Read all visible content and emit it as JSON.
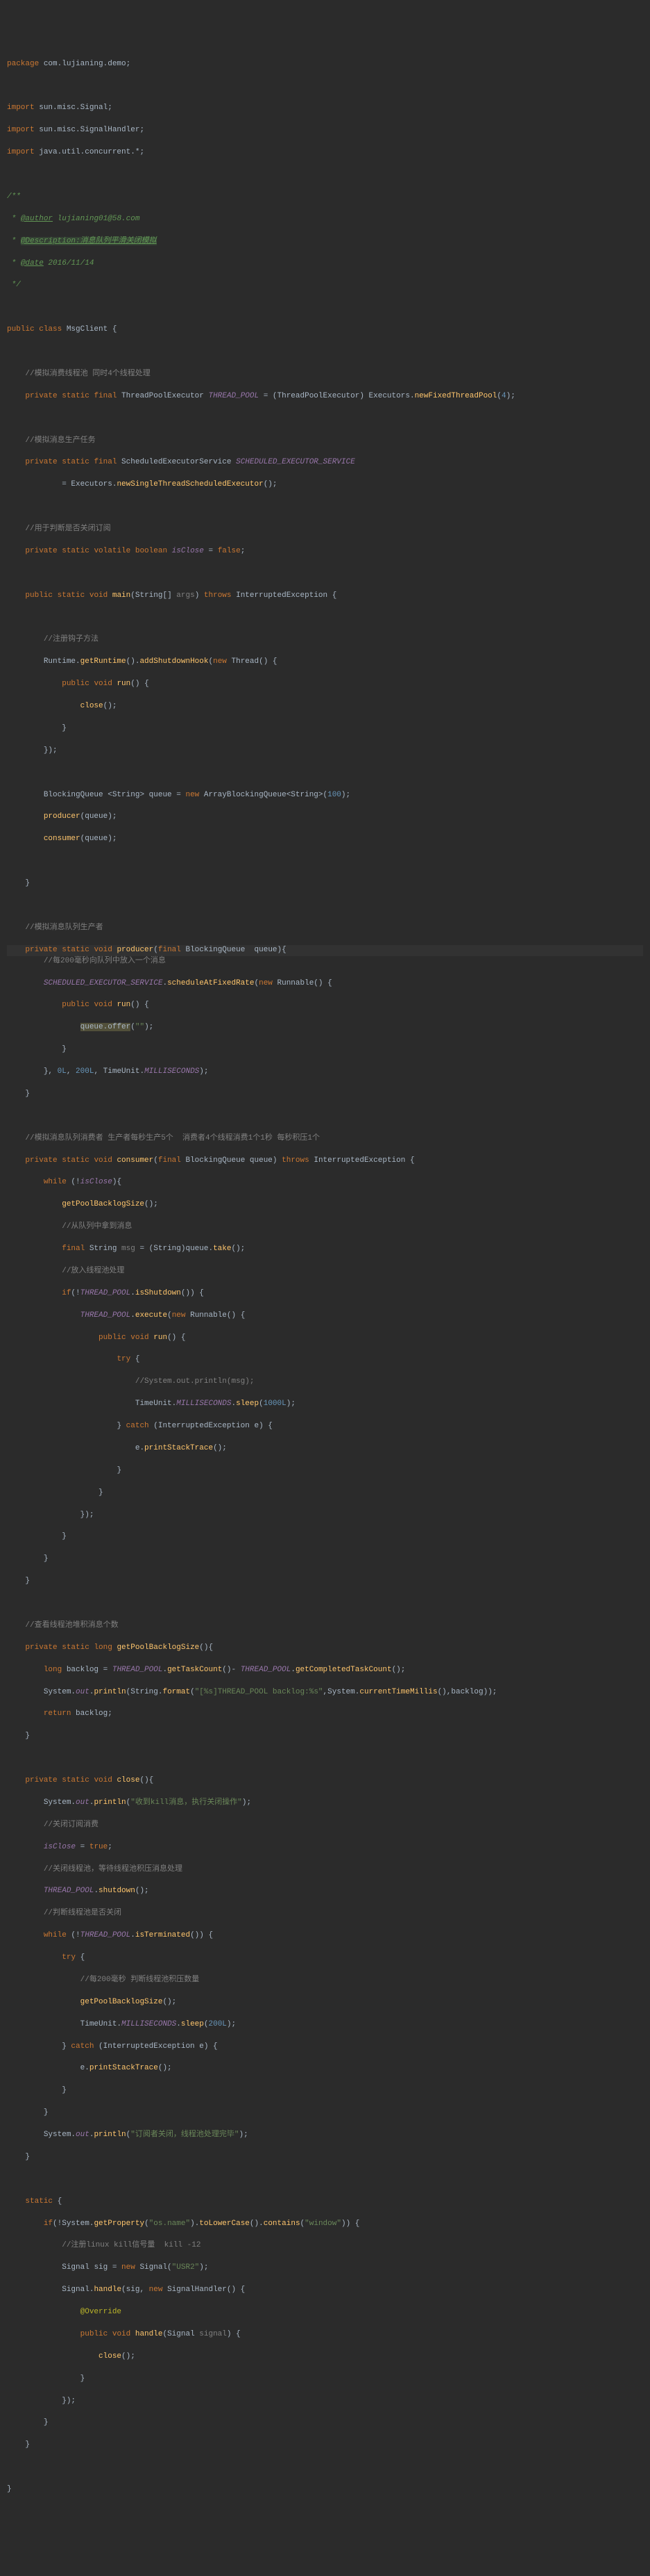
{
  "package_kw": "package ",
  "package_name": "com.lujianing.demo",
  "imports": [
    {
      "kw": "import ",
      "pkg": "sun.misc.Signal"
    },
    {
      "kw": "import ",
      "pkg": "sun.misc.SignalHandler"
    },
    {
      "kw": "import ",
      "pkg": "java.util.concurrent.*"
    }
  ],
  "doc": {
    "open": "/**",
    "author_tag": "@author",
    "author_val": " lujianing01@58.com",
    "desc_tag": "@Description:消息队列平滑关闭模拟",
    "date_tag": "@date",
    "date_val": " 2016/11/14",
    "close": " */"
  },
  "class_decl": {
    "public": "public ",
    "class": "class ",
    "name": "MsgClient ",
    "brace": "{"
  },
  "c_threadpool": "//模拟消费线程池 同时4个线程处理",
  "l_threadpool_1": {
    "priv": "private ",
    "static": "static ",
    "final": "final ",
    "type": "ThreadPoolExecutor ",
    "field": "THREAD_POOL",
    "eq": " = (",
    "cast": "ThreadPoolExecutor",
    "paren": ") ",
    "exec": "Executors",
    "dot": ".",
    "method": "newFixedThreadPool",
    "args": "(",
    "num": "4",
    "end": ");"
  },
  "c_produce": "//模拟消息生产任务",
  "l_sched_1": {
    "priv": "private ",
    "static": "static ",
    "final": "final ",
    "type": "ScheduledExecutorService ",
    "field": "SCHEDULED_EXECUTOR_SERVICE"
  },
  "l_sched_2": {
    "eq": "        = ",
    "exec": "Executors",
    "dot": ".",
    "method": "newSingleThreadScheduledExecutor",
    "end": "();"
  },
  "c_isclose": "//用于判断是否关闭订阅",
  "l_isclose": {
    "priv": "private ",
    "static": "static ",
    "volatile": "volatile ",
    "boolean": "boolean ",
    "field": "isClose",
    "eq": " = ",
    "val": "false",
    "end": ";"
  },
  "main_sig": {
    "pub": "public ",
    "static": "static ",
    "void": "void ",
    "name": "main",
    "args_open": "(String[] ",
    "args_name": "args",
    "args_close": ") ",
    "throws": "throws ",
    "exc": "InterruptedException ",
    "brace": "{"
  },
  "c_hook": "//注册钩子方法",
  "l_runtime": {
    "t1": "Runtime.",
    "m1": "getRuntime",
    "t2": "().",
    "m2": "addShutdownHook",
    "t3": "(",
    "new": "new ",
    "t4": "Thread() {"
  },
  "l_run_decl": {
    "pub": "public ",
    "void": "void ",
    "name": "run",
    "end": "() {"
  },
  "l_close_call": {
    "name": "close",
    "end": "();"
  },
  "l_brace_close": "}",
  "l_hook_end": "});",
  "l_queue": {
    "t1": "BlockingQueue ",
    "gen1": "<String> ",
    "var": "queue ",
    "eq": "= ",
    "new": "new ",
    "t2": "ArrayBlockingQueue<String>(",
    "num": "100",
    "end": ");"
  },
  "l_prod_call": {
    "name": "producer",
    "args": "(queue);"
  },
  "l_cons_call": {
    "name": "consumer",
    "args": "(queue);"
  },
  "c_producer": "//模拟消息队列生产者",
  "prod_sig": {
    "priv": "private ",
    "static": "static ",
    "void": "void ",
    "name": "producer",
    "args_open": "(",
    "final": "final ",
    "type": "BlockingQueue  ",
    "param": "queue",
    "end": "){"
  },
  "c_200ms": "//每200毫秒向队列中放入一个消息",
  "l_sched_call": {
    "field": "SCHEDULED_EXECUTOR_SERVICE",
    "dot": ".",
    "method": "scheduleAtFixedRate",
    "open": "(",
    "new": "new ",
    "t": "Runnable() {"
  },
  "l_offer": {
    "var": "queue",
    "dot": ".",
    "method": "offer",
    "open": "(",
    "str": "\"\"",
    "end": ");"
  },
  "l_sched_end": {
    "t1": "}, ",
    "n1": "0L",
    "t2": ", ",
    "n2": "200L",
    "t3": ", TimeUnit.",
    "f": "MILLISECONDS",
    "end": ");"
  },
  "c_consumer": "//模拟消息队列消费者 生产者每秒生产5个  消费者4个线程消费1个1秒 每秒积压1个",
  "cons_sig": {
    "priv": "private ",
    "static": "static ",
    "void": "void ",
    "name": "consumer",
    "args_open": "(",
    "final": "final ",
    "type": "BlockingQueue ",
    "param": "queue",
    "close": ") ",
    "throws": "throws ",
    "exc": "InterruptedException ",
    "brace": "{"
  },
  "l_while_isclose": {
    "while": "while ",
    "open": "(!",
    "field": "isClose",
    "end": "){"
  },
  "l_getpool": {
    "name": "getPoolBacklogSize",
    "end": "();"
  },
  "c_take": "//从队列中拿到消息",
  "l_take": {
    "final": "final ",
    "t": "String ",
    "var": "msg",
    "eq": " = (String)queue.",
    "method": "take",
    "end": "();"
  },
  "c_into_pool": "//放入线程池处理",
  "l_if_shutdown": {
    "if": "if",
    "open": "(!",
    "field": "THREAD_POOL",
    "dot": ".",
    "method": "isShutdown",
    "end": "()) {"
  },
  "l_execute": {
    "field": "THREAD_POOL",
    "dot": ".",
    "method": "execute",
    "open": "(",
    "new": "new ",
    "t": "Runnable() {"
  },
  "l_try": {
    "try": "try ",
    "brace": "{"
  },
  "c_sysout_msg": "//System.out.println(msg);",
  "l_sleep1000": {
    "t1": "TimeUnit.",
    "f": "MILLISECONDS",
    "dot": ".",
    "method": "sleep",
    "open": "(",
    "num": "1000L",
    "end": ");"
  },
  "l_catch_ie": {
    "close": "} ",
    "catch": "catch ",
    "open": "(InterruptedException e) {"
  },
  "l_printstack": {
    "t": "e.",
    "method": "printStackTrace",
    "end": "();"
  },
  "l_exec_end": "});",
  "c_backlog": "//查看线程池堆积消息个数",
  "backlog_sig": {
    "priv": "private ",
    "static": "static ",
    "long": "long ",
    "name": "getPoolBacklogSize",
    "end": "(){"
  },
  "l_backlog_calc": {
    "long": "long ",
    "var": "backlog ",
    "eq": "= ",
    "f1": "THREAD_POOL",
    "d1": ".",
    "m1": "getTaskCount",
    "t1": "()- ",
    "f2": "THREAD_POOL",
    "d2": ".",
    "m2": "getCompletedTaskCount",
    "end": "();"
  },
  "l_sysout_backlog": {
    "t1": "System.",
    "f1": "out",
    "d1": ".",
    "m1": "println",
    "t2": "(String.",
    "m2": "format",
    "t3": "(",
    "str": "\"[%s]THREAD_POOL backlog:%s\"",
    "t4": ",System.",
    "m3": "currentTimeMillis",
    "t5": "(),backlog));"
  },
  "l_return_backlog": {
    "ret": "return ",
    "var": "backlog;"
  },
  "close_sig": {
    "priv": "private ",
    "static": "static ",
    "void": "void ",
    "name": "close",
    "end": "(){"
  },
  "l_sysout_kill": {
    "t1": "System.",
    "f": "out",
    "d": ".",
    "m": "println",
    "open": "(",
    "str": "\"收到kill消息，执行关闭操作\"",
    "end": ");"
  },
  "c_close_sub": "//关闭订阅消费",
  "l_isclose_true": {
    "field": "isClose",
    "eq": " = ",
    "val": "true",
    "end": ";"
  },
  "c_close_pool": "//关闭线程池，等待线程池积压消息处理",
  "l_shutdown": {
    "field": "THREAD_POOL",
    "dot": ".",
    "method": "shutdown",
    "end": "();"
  },
  "c_check_term": "//判断线程池是否关闭",
  "l_while_term": {
    "while": "while ",
    "open": "(!",
    "field": "THREAD_POOL",
    "dot": ".",
    "method": "isTerminated",
    "end": "()) {"
  },
  "c_200ms_check": "//每200毫秒 判断线程池积压数量",
  "l_sleep200": {
    "t1": "TimeUnit.",
    "f": "MILLISECONDS",
    "dot": ".",
    "method": "sleep",
    "open": "(",
    "num": "200L",
    "end": ");"
  },
  "l_sysout_done": {
    "t1": "System.",
    "f": "out",
    "d": ".",
    "m": "println",
    "open": "(",
    "str": "\"订阅者关闭，线程池处理完毕\"",
    "end": ");"
  },
  "static_block": {
    "static": "static ",
    "brace": "{"
  },
  "l_if_os": {
    "if": "if",
    "open": "(!System.",
    "m1": "getProperty",
    "t1": "(",
    "str1": "\"os.name\"",
    "t2": ").",
    "m2": "toLowerCase",
    "t3": "().",
    "m3": "contains",
    "t4": "(",
    "str2": "\"window\"",
    "end": ")) {"
  },
  "c_reg_linux": "//注册linux kill信号量  kill -12",
  "l_signal_new": {
    "t1": "Signal ",
    "var": "sig ",
    "eq": "= ",
    "new": "new ",
    "t2": "Signal(",
    "str": "\"USR2\"",
    "end": ");"
  },
  "l_signal_handle": {
    "t1": "Signal.",
    "m": "handle",
    "t2": "(sig, ",
    "new": "new ",
    "t3": "SignalHandler() {"
  },
  "l_override": "@Override",
  "l_handle_sig": {
    "pub": "public ",
    "void": "void ",
    "name": "handle",
    "open": "(Signal ",
    "param": "signal",
    "end": ") {"
  }
}
